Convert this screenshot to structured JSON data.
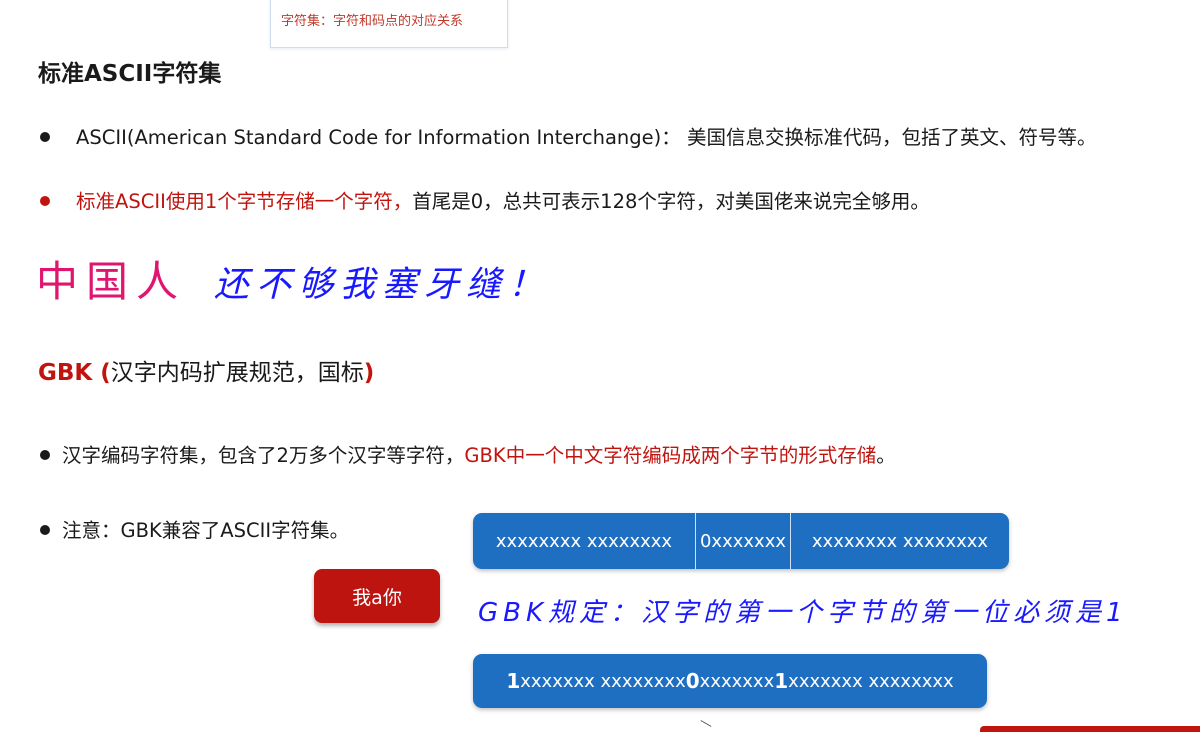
{
  "top_note": "字符集：字符和码点的对应关系",
  "ascii_section": {
    "title": "标准ASCII字符集",
    "bullet1": "ASCII(American Standard Code for Information Interchange)： 美国信息交换标准代码，包括了英文、符号等。",
    "bullet2_red": "标准ASCII使用1个字节存储一个字符，",
    "bullet2_rest": "首尾是0，总共可表示128个字符，对美国佬来说完全够用。"
  },
  "handwriting": {
    "pink": "中国人",
    "blue": "还不够我塞牙缝！"
  },
  "gbk_section": {
    "title_bold": "GBK",
    "title_open": "(",
    "title_text": "汉字内码扩展规范，国标",
    "title_close": ")",
    "bullet1_prefix": "汉字编码字符集，包含了2万多个汉字等字符，",
    "bullet1_red": "GBK中一个中文字符编码成两个字节的形式存储",
    "bullet1_suffix": "。",
    "bullet2": "注意：GBK兼容了ASCII字符集。"
  },
  "button_label": "我a你",
  "bit_box_top": {
    "seg1": "xxxxxxxx  xxxxxxxx",
    "seg2": "0xxxxxxx",
    "seg3": "xxxxxxxx  xxxxxxxx"
  },
  "gbk_rule": "GBK规定：汉字的第一个字节的第一位必须是1",
  "bit_box_bottom": {
    "lead1": "1",
    "part1": "xxxxxxx  xxxxxxxx ",
    "lead2": "0",
    "part2": "xxxxxxx  ",
    "lead3": "1",
    "part3": "xxxxxxx  xxxxxxxx"
  },
  "colors": {
    "red": "#c0140f",
    "blue_box": "#1e6fc2",
    "pink_handwriting": "#e0156f",
    "blue_handwriting": "#1919ff"
  }
}
